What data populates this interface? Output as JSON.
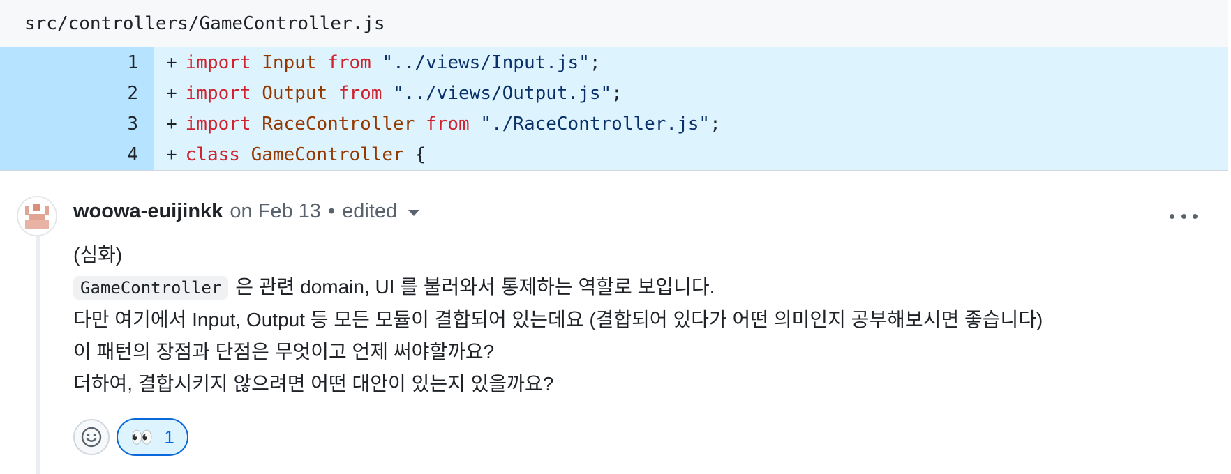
{
  "file": {
    "path": "src/controllers/GameController.js"
  },
  "diff": {
    "lines": [
      {
        "num": "1",
        "plus": "+",
        "tokens": [
          {
            "t": "import",
            "c": "kw"
          },
          {
            "t": " ",
            "c": ""
          },
          {
            "t": "Input",
            "c": "id"
          },
          {
            "t": " ",
            "c": ""
          },
          {
            "t": "from",
            "c": "kw"
          },
          {
            "t": " ",
            "c": ""
          },
          {
            "t": "\"../views/Input.js\"",
            "c": "str"
          },
          {
            "t": ";",
            "c": ""
          }
        ]
      },
      {
        "num": "2",
        "plus": "+",
        "tokens": [
          {
            "t": "import",
            "c": "kw"
          },
          {
            "t": " ",
            "c": ""
          },
          {
            "t": "Output",
            "c": "id"
          },
          {
            "t": " ",
            "c": ""
          },
          {
            "t": "from",
            "c": "kw"
          },
          {
            "t": " ",
            "c": ""
          },
          {
            "t": "\"../views/Output.js\"",
            "c": "str"
          },
          {
            "t": ";",
            "c": ""
          }
        ]
      },
      {
        "num": "3",
        "plus": "+",
        "tokens": [
          {
            "t": "import",
            "c": "kw"
          },
          {
            "t": " ",
            "c": ""
          },
          {
            "t": "RaceController",
            "c": "id"
          },
          {
            "t": " ",
            "c": ""
          },
          {
            "t": "from",
            "c": "kw"
          },
          {
            "t": " ",
            "c": ""
          },
          {
            "t": "\"./RaceController.js\"",
            "c": "str"
          },
          {
            "t": ";",
            "c": ""
          }
        ]
      },
      {
        "num": "4",
        "plus": "+",
        "tokens": [
          {
            "t": "class",
            "c": "kw"
          },
          {
            "t": " ",
            "c": ""
          },
          {
            "t": "GameController",
            "c": "id"
          },
          {
            "t": " {",
            "c": ""
          }
        ]
      }
    ]
  },
  "comment": {
    "author": "woowa-euijinkk",
    "date": "on Feb 13",
    "separator": "•",
    "edited": "edited",
    "body": {
      "line1": "(심화)",
      "code": "GameController",
      "line2_rest": "은 관련 domain, UI 를 불러와서 통제하는 역할로 보입니다.",
      "line3": "다만 여기에서 Input, Output 등 모든 모듈이 결합되어 있는데요 (결합되어 있다가 어떤 의미인지 공부해보시면 좋습니다)",
      "line4": "이 패턴의 장점과 단점은 무엇이고 언제 써야할까요?",
      "line5": "더하여, 결합시키지 않으려면 어떤 대안이 있는지 있을까요?"
    },
    "reactions": [
      {
        "emoji": "👀",
        "count": "1"
      }
    ]
  },
  "colors": {
    "keyword": "#cf222e",
    "identifier": "#953800",
    "string": "#0a3069",
    "added_line_bg": "#ddf4ff",
    "added_num_bg": "#b6e3ff",
    "accent": "#0969da"
  }
}
